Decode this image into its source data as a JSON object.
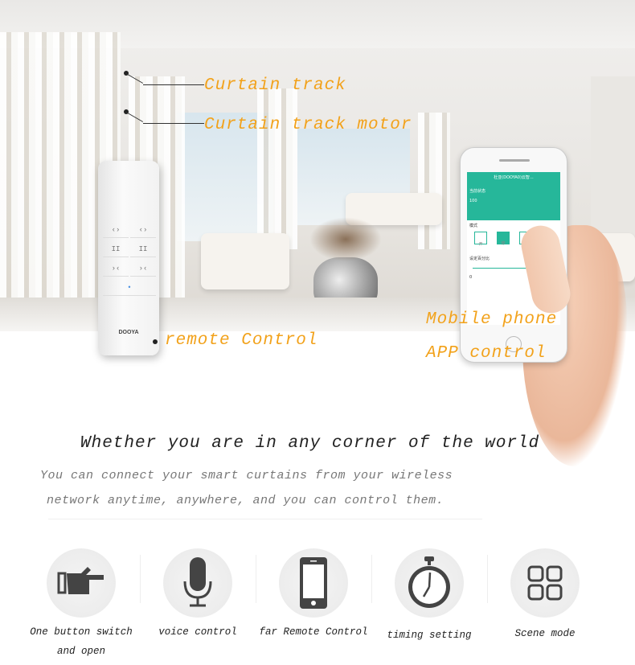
{
  "labels": {
    "track": "Curtain track",
    "motor": "Curtain track motor",
    "remote": "remote Control",
    "mobile1": "Mobile phone",
    "mobile2": "APP control"
  },
  "remote": {
    "brand": "DOOYA"
  },
  "phone_app": {
    "title": "杜亚(DOOYA0)云智...",
    "status_label": "当前状态",
    "status_value": "100",
    "mode_label": "模式",
    "modes": [
      "开",
      "停",
      "关"
    ],
    "percent_label": "设定百分比",
    "percent_value": "0",
    "accent": "#26b79a"
  },
  "headline": "Whether you are in any corner of the world",
  "subtitle": [
    "You can connect your smart curtains from your wireless",
    "network anytime, anywhere, and you can control them."
  ],
  "features": [
    {
      "icon": "pointing-hand-icon",
      "label": "One button switch",
      "label2": "and open"
    },
    {
      "icon": "microphone-icon",
      "label": "voice control"
    },
    {
      "icon": "smartphone-icon",
      "label": "far Remote Control"
    },
    {
      "icon": "stopwatch-icon",
      "label": "timing setting"
    },
    {
      "icon": "grid-icon",
      "label": "Scene mode"
    }
  ],
  "colors": {
    "label": "#f2a21b",
    "icon": "#444444"
  }
}
